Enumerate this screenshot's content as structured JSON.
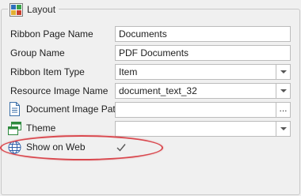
{
  "group": {
    "title": "Layout",
    "icon": "layout-icon"
  },
  "fields": {
    "ribbon_page_name": {
      "label": "Ribbon Page Name",
      "value": "Documents"
    },
    "group_name": {
      "label": "Group Name",
      "value": "PDF Documents"
    },
    "ribbon_item_type": {
      "label": "Ribbon Item Type",
      "value": "Item"
    },
    "resource_image_name": {
      "label": "Resource Image Name",
      "value": "document_text_32"
    },
    "document_image_path": {
      "label": "Document Image Path",
      "value": "",
      "icon": "document-icon",
      "button": "..."
    },
    "theme": {
      "label": "Theme",
      "value": "",
      "icon": "window-theme-icon"
    },
    "show_on_web": {
      "label": "Show on Web",
      "checked": true,
      "icon": "globe-icon"
    }
  },
  "colors": {
    "highlight": "#d9484e",
    "field_border": "#bcbcbc",
    "background": "#f0f0f0"
  }
}
